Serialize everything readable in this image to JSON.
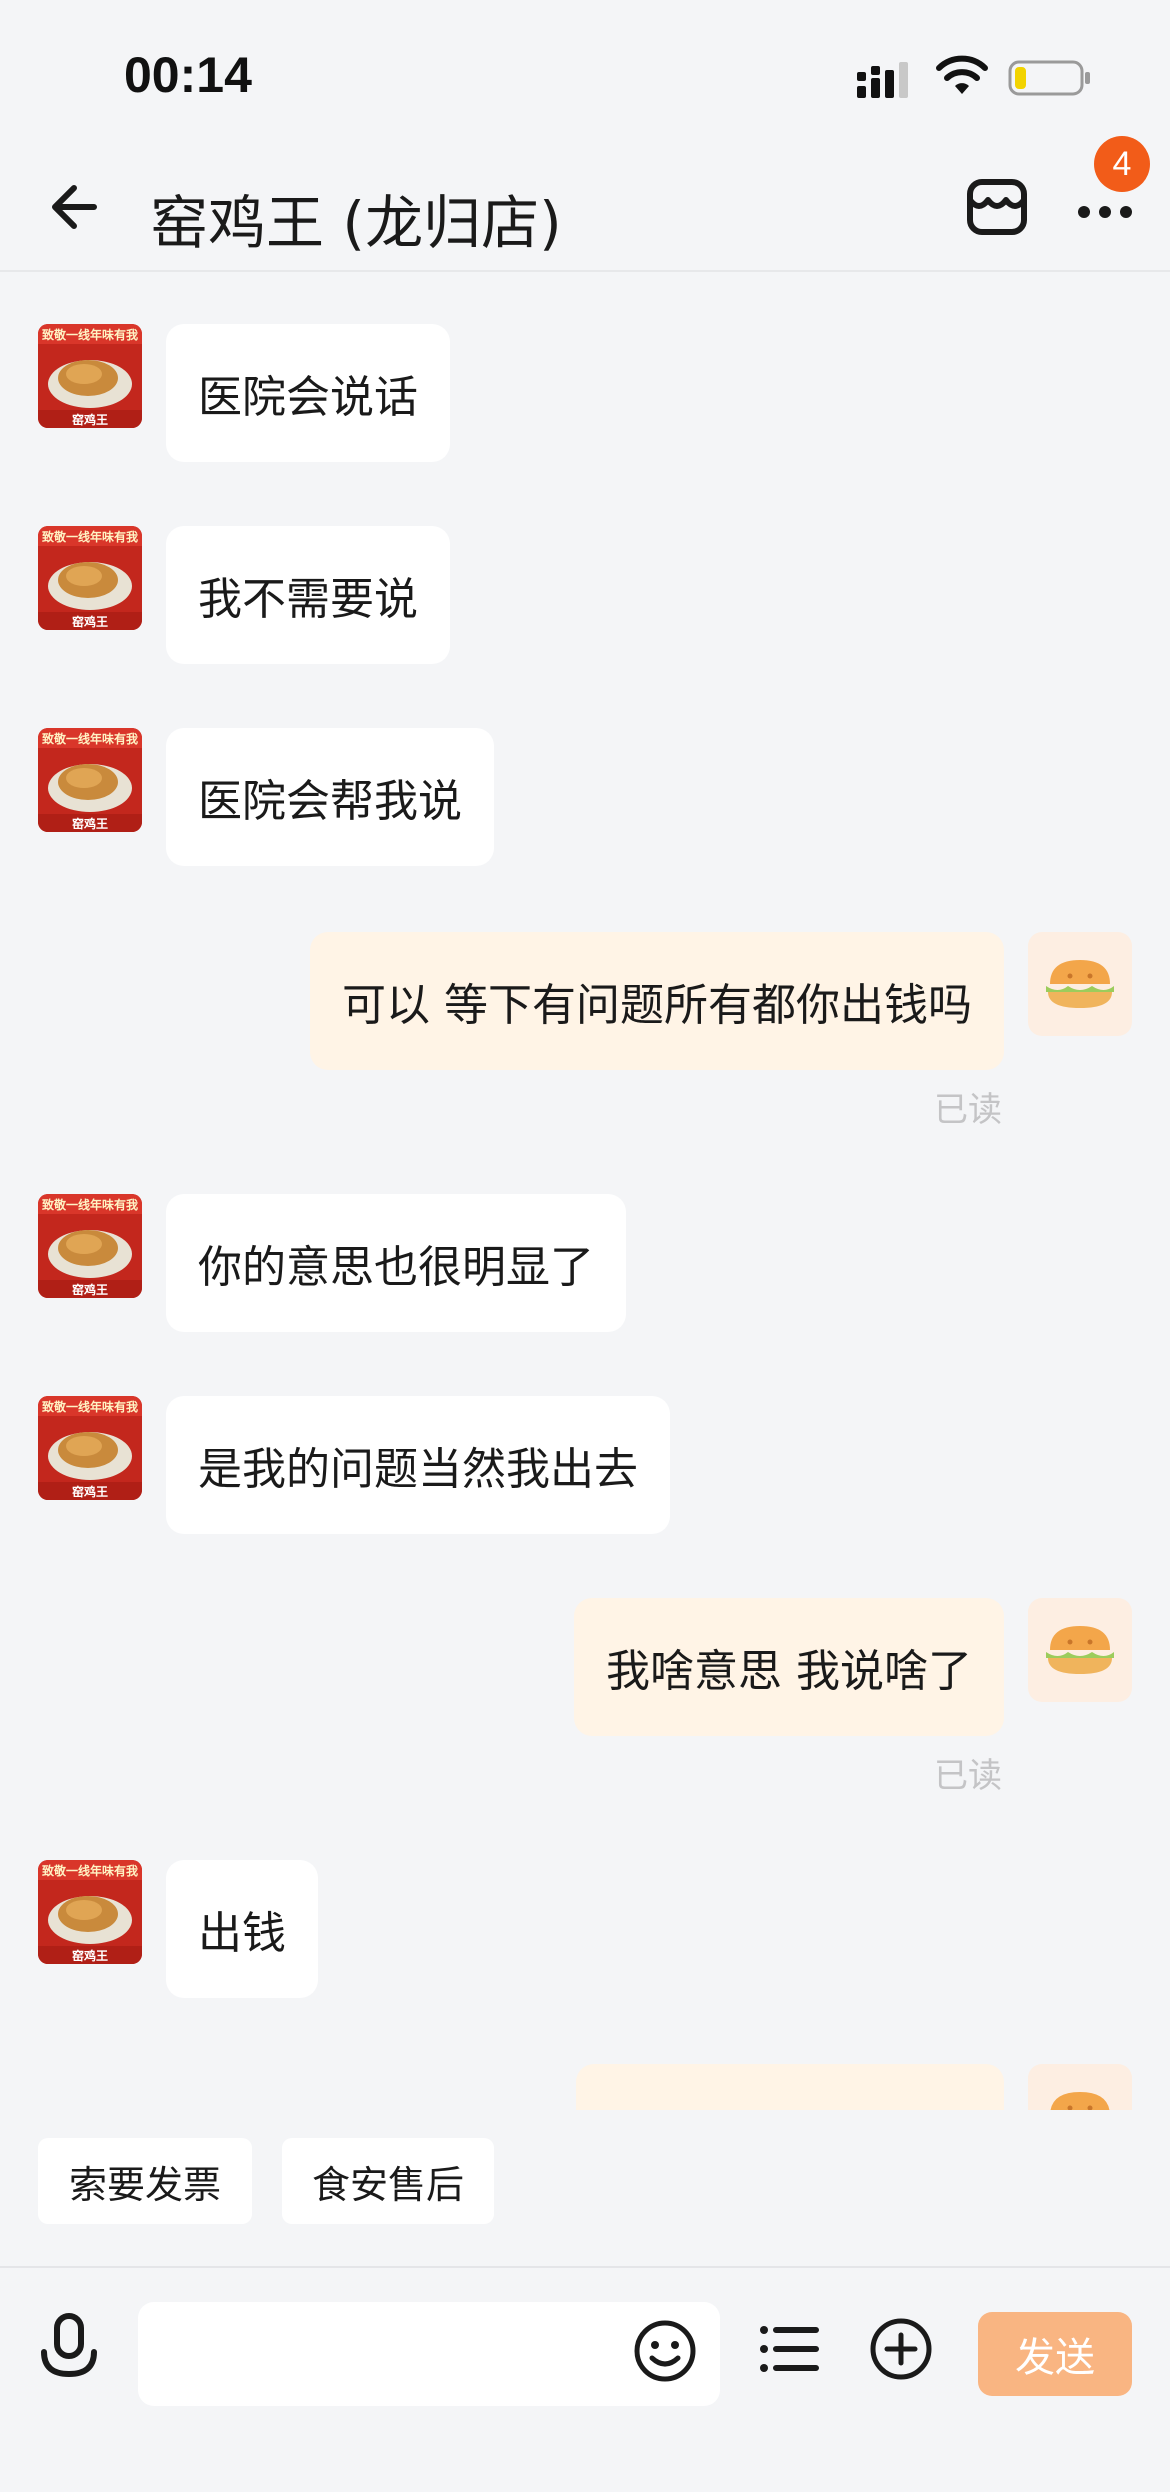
{
  "status_bar": {
    "time": "00:14"
  },
  "header": {
    "title": "窑鸡王 (龙归店)",
    "more_badge": "4"
  },
  "shop_avatar_text": {
    "banner": "致敬一线年味有我",
    "brand": "窑鸡王"
  },
  "messages": [
    {
      "side": "in",
      "text": "医院会说话"
    },
    {
      "side": "in",
      "text": "我不需要说"
    },
    {
      "side": "in",
      "text": "医院会帮我说"
    },
    {
      "side": "out",
      "text": "可以 等下有问题所有都你出钱吗",
      "status": "已读"
    },
    {
      "side": "in",
      "text": "你的意思也很明显了"
    },
    {
      "side": "in",
      "text": "是我的问题当然我出去"
    },
    {
      "side": "out",
      "text": "我啥意思 我说啥了",
      "status": "已读"
    },
    {
      "side": "in",
      "text": "出钱"
    },
    {
      "side": "out",
      "text": ""
    }
  ],
  "quick_actions": [
    "索要发票",
    "食安售后"
  ],
  "input": {
    "placeholder": "",
    "send_label": "发送"
  },
  "colors": {
    "accent": "#f25c19",
    "send_button": "#f9b582",
    "outgoing_bubble": "#fff4e6",
    "background": "#f4f5f7"
  }
}
